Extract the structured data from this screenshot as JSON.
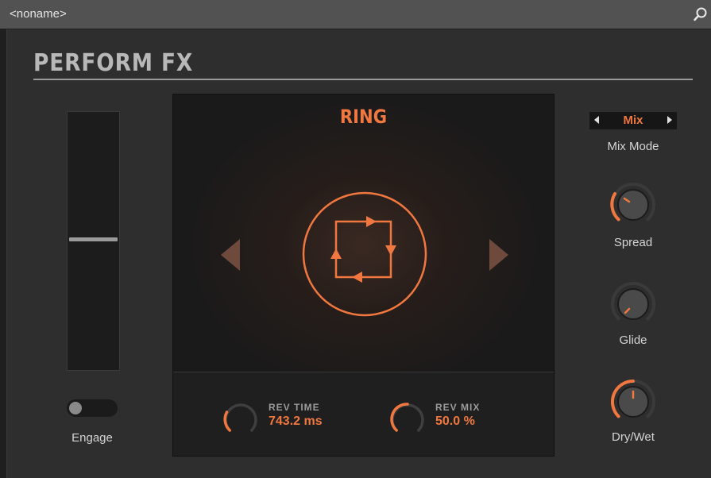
{
  "titlebar": {
    "preset_name": "<noname>"
  },
  "header": {
    "title": "PERFORM FX"
  },
  "left": {
    "fader_level": 0.5,
    "engage_label": "Engage",
    "engage_on": false
  },
  "screen": {
    "effect_name": "RING",
    "params": [
      {
        "label": "REV TIME",
        "value": "743.2 ms"
      },
      {
        "label": "REV MIX",
        "value": "50.0 %"
      }
    ]
  },
  "right": {
    "mix_mode_value": "Mix",
    "mix_mode_label": "Mix Mode",
    "knobs": [
      {
        "label": "Spread"
      },
      {
        "label": "Glide"
      },
      {
        "label": "Dry/Wet"
      }
    ]
  },
  "colors": {
    "accent": "#f07840",
    "panel": "#2e2e2e",
    "titlebar": "#525252"
  },
  "icons": [
    "search-icon",
    "ring-effect-icon",
    "previous-arrow-icon",
    "next-arrow-icon"
  ]
}
